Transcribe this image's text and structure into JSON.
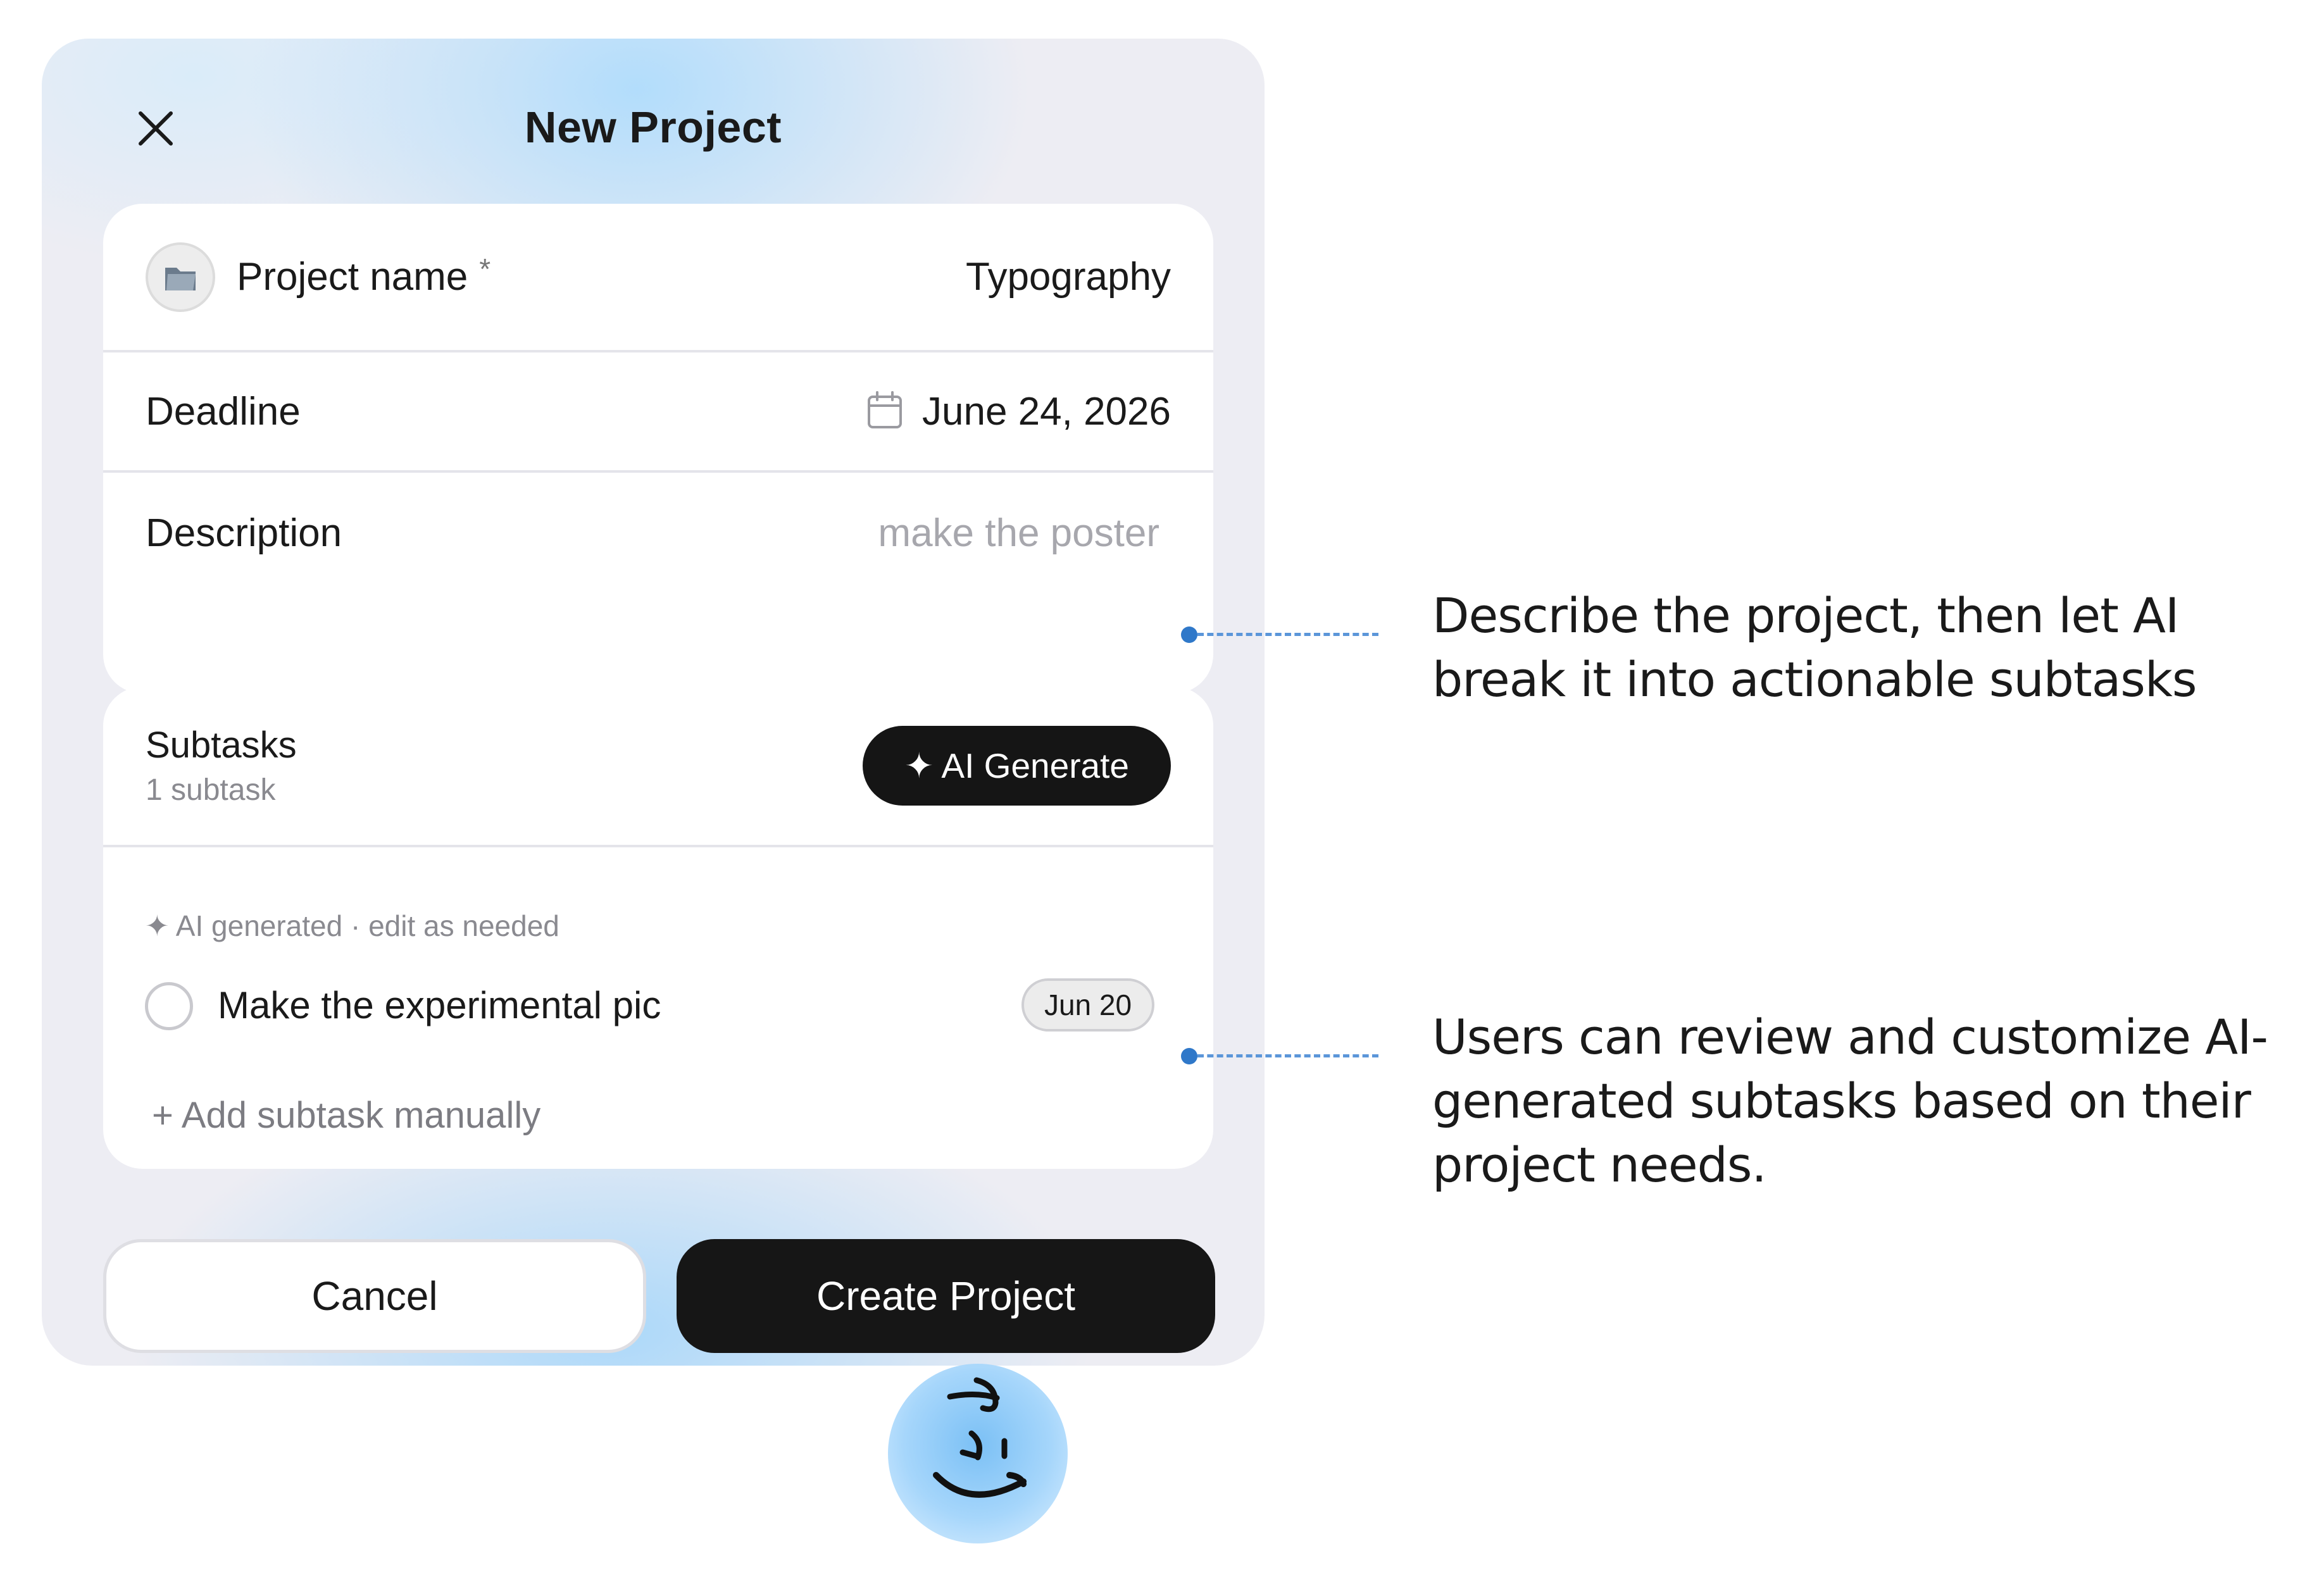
{
  "modal": {
    "title": "New Project",
    "close_icon": "close-icon"
  },
  "details": {
    "project_name_label": "Project name",
    "required_mark": "*",
    "project_name_value": "Typography",
    "folder_icon": "folder-icon",
    "deadline_label": "Deadline",
    "deadline_value": "June 24, 2026",
    "calendar_icon": "calendar-icon",
    "description_label": "Description",
    "description_placeholder": "make the poster"
  },
  "subtasks": {
    "title": "Subtasks",
    "count": "1 subtask",
    "ai_button_label": "✦ AI Generate",
    "ai_note": "✦ AI generated · edit as needed",
    "items": [
      {
        "text": "Make the experimental pic",
        "due": "Jun 20"
      }
    ],
    "add_manual_label": "+ Add subtask manually"
  },
  "actions": {
    "cancel_label": "Cancel",
    "create_label": "Create Project"
  },
  "callouts": [
    "Describe the project, then let AI break it into actionable subtasks",
    "Users can review and customize AI-generated subtasks based on their project needs."
  ],
  "mascot_icon": "smiley-mascot-icon",
  "colors": {
    "accent_blue": "#2f78c9",
    "button_dark": "#161616",
    "modal_bg": "#ededf3",
    "gradient_blue": "#afdcfc"
  }
}
